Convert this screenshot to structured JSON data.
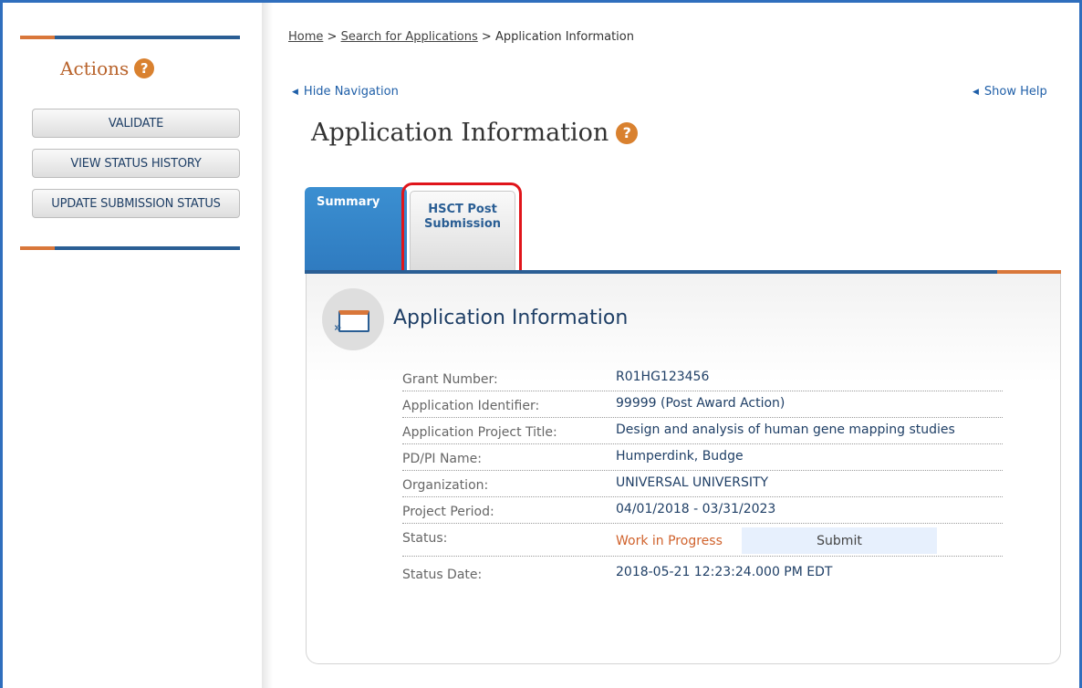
{
  "sidebar": {
    "title": "Actions",
    "help_glyph": "?",
    "buttons": {
      "validate": "VALIDATE",
      "view_status_history": "VIEW STATUS HISTORY",
      "update_submission_status": "UPDATE SUBMISSION STATUS"
    }
  },
  "breadcrumb": {
    "home": "Home",
    "sep1": " > ",
    "search": "Search for Applications",
    "sep2": " > ",
    "current": "Application Information"
  },
  "nav": {
    "hide_navigation": "Hide Navigation",
    "show_help": "Show Help",
    "arrow_glyph": "◀"
  },
  "page": {
    "title": "Application Information",
    "help_glyph": "?"
  },
  "tabs": {
    "summary": "Summary",
    "hsct_line1": "HSCT Post",
    "hsct_line2": "Submission"
  },
  "panel": {
    "title": "Application Information",
    "rows": [
      {
        "label": "Grant Number:",
        "value": "R01HG123456"
      },
      {
        "label": "Application Identifier:",
        "value": "99999 (Post Award Action)"
      },
      {
        "label": "Application Project Title:",
        "value": "Design and analysis of human gene mapping studies"
      },
      {
        "label": "PD/PI Name:",
        "value": "Humperdink, Budge"
      },
      {
        "label": "Organization:",
        "value": "UNIVERSAL UNIVERSITY"
      },
      {
        "label": "Project Period:",
        "value": "04/01/2018 - 03/31/2023"
      }
    ],
    "status_label": "Status:",
    "status_value": "Work in Progress",
    "submit_label": "Submit",
    "status_date_label": "Status Date:",
    "status_date_value": "2018-05-21 12:23:24.000 PM EDT"
  },
  "colors": {
    "brand_blue": "#2f6ebd",
    "accent_orange": "#d9773a",
    "status_orange": "#d0622c",
    "highlight_red": "#e0151b"
  },
  "icons": {
    "help": "question-circle-icon",
    "arrow": "triangle-left-icon",
    "panel": "window-expand-icon"
  }
}
